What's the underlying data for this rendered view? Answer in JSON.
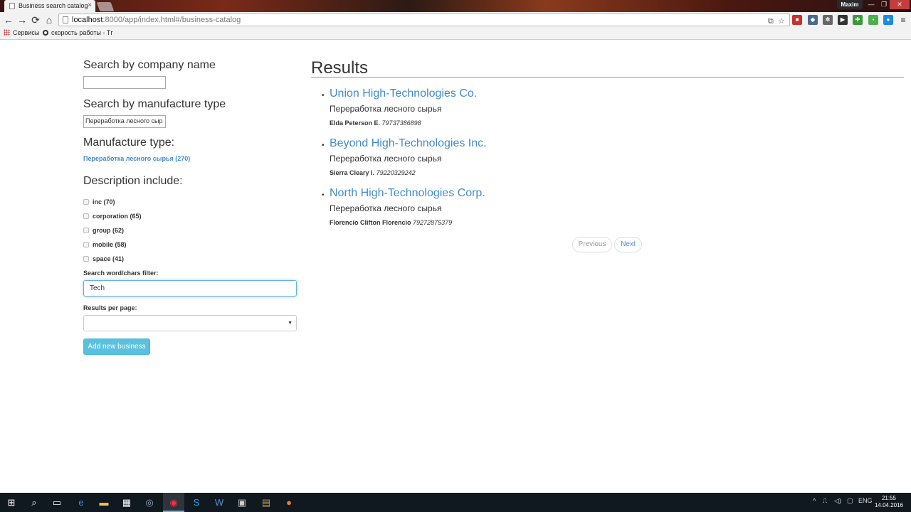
{
  "browser": {
    "tab_title": "Business search catalog",
    "tab_close": "×",
    "user_name": "Maxim",
    "url_host": "localhost",
    "url_rest": ":8000/app/index.html#/business-catalog",
    "bookmarks": [
      {
        "label": "Сервисы"
      },
      {
        "label": "скорость работы - Тг"
      }
    ],
    "nav": {
      "back": "←",
      "forward": "→",
      "reload": "⟳",
      "home": "⌂"
    },
    "window_buttons": {
      "minimize": "—",
      "maximize": "❐",
      "close": "✕"
    }
  },
  "sidebar": {
    "company_heading": "Search by company name",
    "company_value": "",
    "manufacture_heading": "Search by manufacture type",
    "manufacture_value": "Переработка лесного сыр",
    "manufacture_type_heading": "Manufacture type:",
    "manufacture_type_link": "Переработка лесного сырья (270)",
    "description_heading": "Description include:",
    "description_options": [
      {
        "label": "inc (70)",
        "checked": false
      },
      {
        "label": "corporation (65)",
        "checked": false
      },
      {
        "label": "group (62)",
        "checked": false
      },
      {
        "label": "mobile (58)",
        "checked": false
      },
      {
        "label": "space (41)",
        "checked": false
      }
    ],
    "filter_label": "Search word/chars filter:",
    "filter_value": "Tech",
    "per_page_label": "Results per page:",
    "per_page_value": "",
    "add_button": "Add new business"
  },
  "results": {
    "title": "Results",
    "items": [
      {
        "name": "Union High-Technologies Co.",
        "type": "Переработка лесного сырья",
        "contact_name": "Elda Peterson E.",
        "phone": "79737386898"
      },
      {
        "name": "Beyond High-Technologies Inc.",
        "type": "Переработка лесного сырья",
        "contact_name": "Sierra Cleary I.",
        "phone": "79220329242"
      },
      {
        "name": "North High-Technologies Corp.",
        "type": "Переработка лесного сырья",
        "contact_name": "Florencio Clifton Florencio",
        "phone": "79272875379"
      }
    ],
    "pager": {
      "previous": "Previous",
      "next": "Next"
    }
  },
  "taskbar": {
    "language": "ENG",
    "time": "21:55",
    "date": "14.04.2016"
  }
}
